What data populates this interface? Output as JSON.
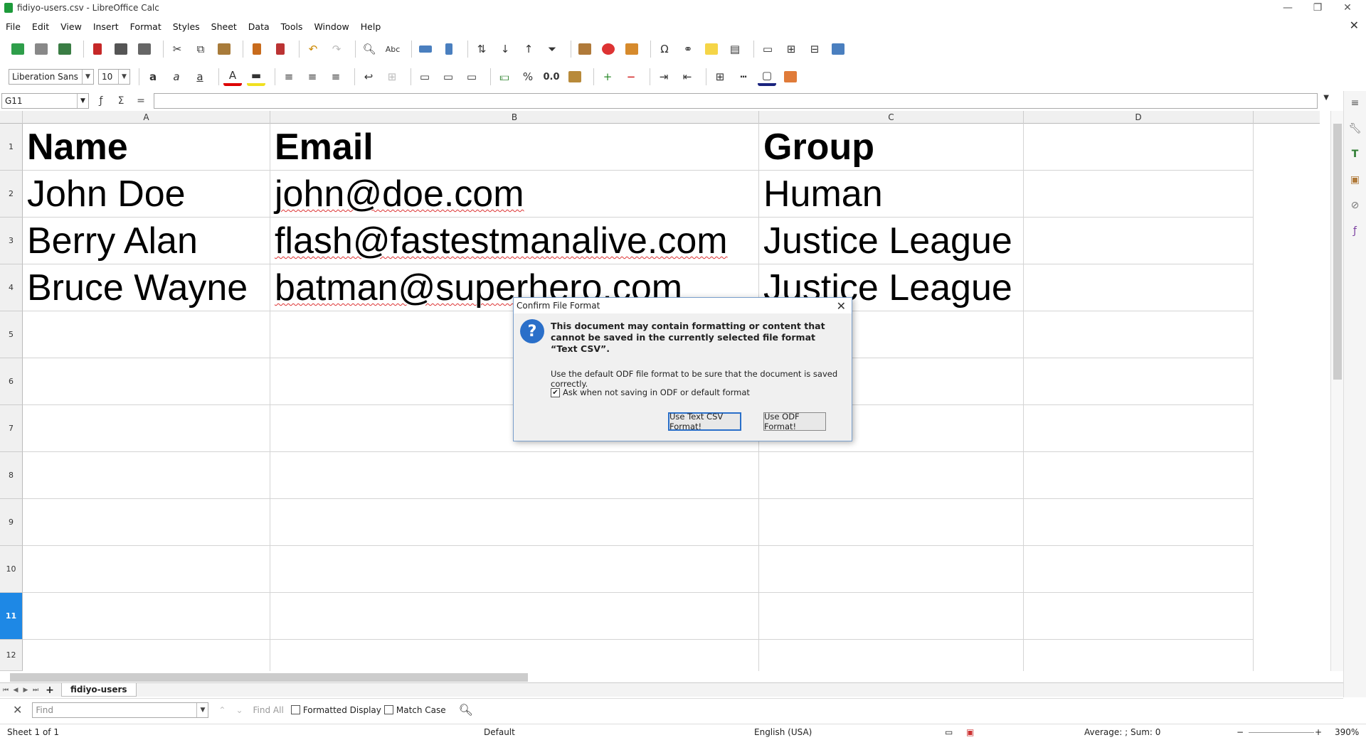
{
  "window": {
    "title": "fidiyo-users.csv - LibreOffice Calc"
  },
  "menu": [
    "File",
    "Edit",
    "View",
    "Insert",
    "Format",
    "Styles",
    "Sheet",
    "Data",
    "Tools",
    "Window",
    "Help"
  ],
  "format_toolbar": {
    "font_name": "Liberation Sans",
    "font_size": "10",
    "percent": "%",
    "decimal": "0.0"
  },
  "formula_bar": {
    "cell_ref": "G11",
    "formula": ""
  },
  "columns": [
    "A",
    "B",
    "C",
    "D"
  ],
  "rows": [
    "1",
    "2",
    "3",
    "4",
    "5",
    "6",
    "7",
    "8",
    "9",
    "10",
    "11",
    "12"
  ],
  "active_row": "11",
  "sheet": {
    "header": [
      "Name",
      "Email",
      "Group"
    ],
    "data": [
      [
        "John Doe",
        "john@doe.com",
        "Human"
      ],
      [
        "Berry Alan",
        "flash@fastestmanalive.com",
        "Justice League"
      ],
      [
        "Bruce Wayne",
        "batman@superhero.com",
        "Justice League"
      ]
    ]
  },
  "sheet_tabs": [
    "fidiyo-users"
  ],
  "find_bar": {
    "placeholder": "Find",
    "find_all": "Find All",
    "formatted_display": "Formatted Display",
    "match_case": "Match Case"
  },
  "status": {
    "sheet": "Sheet 1 of 1",
    "page_style": "Default",
    "language": "English (USA)",
    "summary": "Average: ; Sum: 0",
    "zoom": "390%"
  },
  "dialog": {
    "title": "Confirm File Format",
    "message": "This document may contain formatting or content that cannot be saved in the currently selected file format “Text CSV”.",
    "secondary": "Use the default ODF file format to be sure that the document is saved correctly.",
    "checkbox_label": "Ask when not saving in ODF or default format",
    "checkbox_checked": true,
    "primary_button": "Use Text CSV Format!",
    "secondary_button": "Use ODF Format!"
  },
  "colors": {
    "accent": "#1e88e5",
    "dialog_border": "#7a9fcc",
    "question_icon": "#2a6fc9"
  }
}
